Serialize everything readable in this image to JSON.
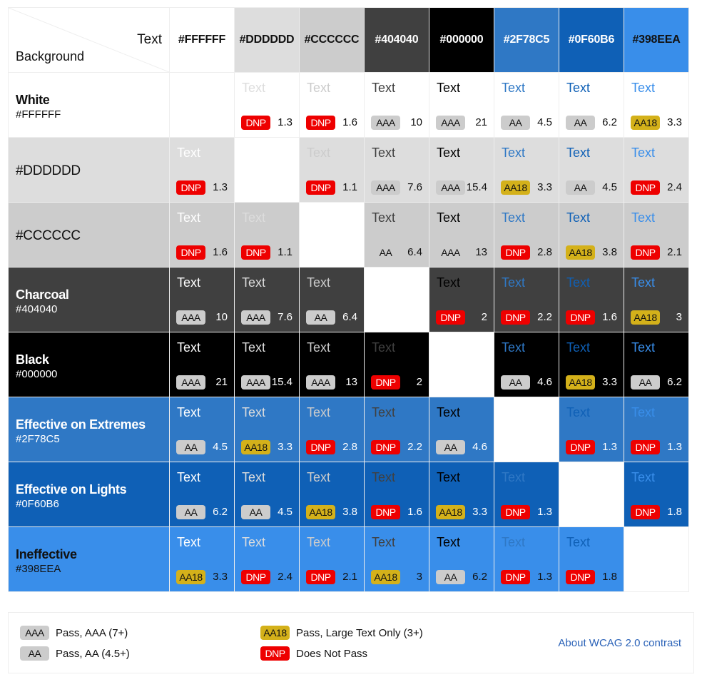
{
  "corner": {
    "text_label": "Text",
    "background_label": "Background"
  },
  "columns": [
    {
      "hex": "#FFFFFF",
      "color": "#FFFFFF",
      "label_color": "#111111"
    },
    {
      "hex": "#DDDDDD",
      "color": "#DDDDDD",
      "label_color": "#111111"
    },
    {
      "hex": "#CCCCCC",
      "color": "#CCCCCC",
      "label_color": "#111111"
    },
    {
      "hex": "#404040",
      "color": "#404040",
      "label_color": "#FFFFFF"
    },
    {
      "hex": "#000000",
      "color": "#000000",
      "label_color": "#FFFFFF"
    },
    {
      "hex": "#2F78C5",
      "color": "#2F78C5",
      "label_color": "#FFFFFF"
    },
    {
      "hex": "#0F60B6",
      "color": "#0F60B6",
      "label_color": "#FFFFFF"
    },
    {
      "hex": "#398EEA",
      "color": "#398EEA",
      "label_color": "#111111"
    }
  ],
  "rows": [
    {
      "name": "White",
      "hex": "#FFFFFF",
      "color": "#FFFFFF",
      "label_color": "#111111",
      "ratio_color": "#111111",
      "cells": [
        null,
        {
          "rating": "DNP",
          "ratio": "1.3"
        },
        {
          "rating": "DNP",
          "ratio": "1.6"
        },
        {
          "rating": "AAA",
          "ratio": "10"
        },
        {
          "rating": "AAA",
          "ratio": "21"
        },
        {
          "rating": "AA",
          "ratio": "4.5"
        },
        {
          "rating": "AA",
          "ratio": "6.2"
        },
        {
          "rating": "AA18",
          "ratio": "3.3"
        }
      ]
    },
    {
      "name": "#DDDDDD",
      "hex": "",
      "color": "#DDDDDD",
      "label_color": "#111111",
      "ratio_color": "#111111",
      "cells": [
        {
          "rating": "DNP",
          "ratio": "1.3"
        },
        null,
        {
          "rating": "DNP",
          "ratio": "1.1"
        },
        {
          "rating": "AAA",
          "ratio": "7.6"
        },
        {
          "rating": "AAA",
          "ratio": "15.4"
        },
        {
          "rating": "AA18",
          "ratio": "3.3"
        },
        {
          "rating": "AA",
          "ratio": "4.5"
        },
        {
          "rating": "DNP",
          "ratio": "2.4"
        }
      ]
    },
    {
      "name": "#CCCCCC",
      "hex": "",
      "color": "#CCCCCC",
      "label_color": "#111111",
      "ratio_color": "#111111",
      "cells": [
        {
          "rating": "DNP",
          "ratio": "1.6"
        },
        {
          "rating": "DNP",
          "ratio": "1.1"
        },
        null,
        {
          "rating": "AA",
          "ratio": "6.4"
        },
        {
          "rating": "AAA",
          "ratio": "13"
        },
        {
          "rating": "DNP",
          "ratio": "2.8"
        },
        {
          "rating": "AA18",
          "ratio": "3.8"
        },
        {
          "rating": "DNP",
          "ratio": "2.1"
        }
      ]
    },
    {
      "name": "Charcoal",
      "hex": "#404040",
      "color": "#404040",
      "label_color": "#FFFFFF",
      "ratio_color": "#FFFFFF",
      "cells": [
        {
          "rating": "AAA",
          "ratio": "10"
        },
        {
          "rating": "AAA",
          "ratio": "7.6"
        },
        {
          "rating": "AA",
          "ratio": "6.4"
        },
        null,
        {
          "rating": "DNP",
          "ratio": "2"
        },
        {
          "rating": "DNP",
          "ratio": "2.2"
        },
        {
          "rating": "DNP",
          "ratio": "1.6"
        },
        {
          "rating": "AA18",
          "ratio": "3"
        }
      ]
    },
    {
      "name": "Black",
      "hex": "#000000",
      "color": "#000000",
      "label_color": "#FFFFFF",
      "ratio_color": "#FFFFFF",
      "cells": [
        {
          "rating": "AAA",
          "ratio": "21"
        },
        {
          "rating": "AAA",
          "ratio": "15.4"
        },
        {
          "rating": "AAA",
          "ratio": "13"
        },
        {
          "rating": "DNP",
          "ratio": "2"
        },
        null,
        {
          "rating": "AA",
          "ratio": "4.6"
        },
        {
          "rating": "AA18",
          "ratio": "3.3"
        },
        {
          "rating": "AA",
          "ratio": "6.2"
        }
      ]
    },
    {
      "name": "Effective on Extremes",
      "hex": "#2F78C5",
      "color": "#2F78C5",
      "label_color": "#FFFFFF",
      "ratio_color": "#FFFFFF",
      "cells": [
        {
          "rating": "AA",
          "ratio": "4.5"
        },
        {
          "rating": "AA18",
          "ratio": "3.3"
        },
        {
          "rating": "DNP",
          "ratio": "2.8"
        },
        {
          "rating": "DNP",
          "ratio": "2.2"
        },
        {
          "rating": "AA",
          "ratio": "4.6"
        },
        null,
        {
          "rating": "DNP",
          "ratio": "1.3"
        },
        {
          "rating": "DNP",
          "ratio": "1.3"
        }
      ]
    },
    {
      "name": "Effective on Lights",
      "hex": "#0F60B6",
      "color": "#0F60B6",
      "label_color": "#FFFFFF",
      "ratio_color": "#FFFFFF",
      "cells": [
        {
          "rating": "AA",
          "ratio": "6.2"
        },
        {
          "rating": "AA",
          "ratio": "4.5"
        },
        {
          "rating": "AA18",
          "ratio": "3.8"
        },
        {
          "rating": "DNP",
          "ratio": "1.6"
        },
        {
          "rating": "AA18",
          "ratio": "3.3"
        },
        {
          "rating": "DNP",
          "ratio": "1.3"
        },
        null,
        {
          "rating": "DNP",
          "ratio": "1.8"
        }
      ]
    },
    {
      "name": "Ineffective",
      "hex": "#398EEA",
      "color": "#398EEA",
      "label_color": "#111111",
      "ratio_color": "#111111",
      "cells": [
        {
          "rating": "AA18",
          "ratio": "3.3"
        },
        {
          "rating": "DNP",
          "ratio": "2.4"
        },
        {
          "rating": "DNP",
          "ratio": "2.1"
        },
        {
          "rating": "AA18",
          "ratio": "3"
        },
        {
          "rating": "AA",
          "ratio": "6.2"
        },
        {
          "rating": "DNP",
          "ratio": "1.3"
        },
        {
          "rating": "DNP",
          "ratio": "1.8"
        },
        null
      ]
    }
  ],
  "sample_text": "Text",
  "legend": {
    "items": [
      {
        "badge": "AAA",
        "label": "Pass, AAA (7+)"
      },
      {
        "badge": "AA",
        "label": "Pass, AA (4.5+)"
      },
      {
        "badge": "AA18",
        "label": "Pass, Large Text Only (3+)"
      },
      {
        "badge": "DNP",
        "label": "Does Not Pass"
      }
    ],
    "link_label": "About WCAG 2.0 contrast"
  }
}
